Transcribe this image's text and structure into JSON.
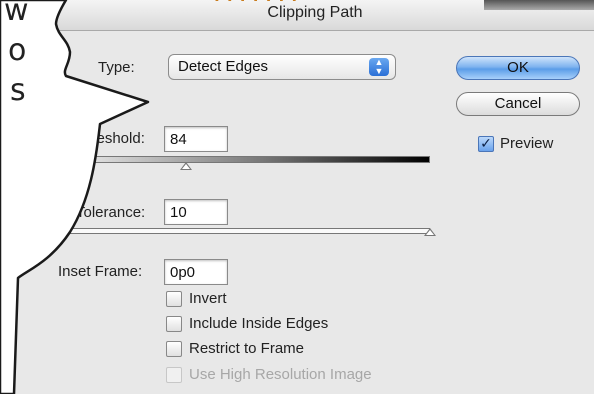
{
  "dialog": {
    "title": "Clipping Path"
  },
  "type_row": {
    "label": "Type:",
    "value": "Detect Edges",
    "arrows_glyph": "▲▼"
  },
  "threshold": {
    "label": "Threshold:",
    "value": "84",
    "slider_fraction": 0.34
  },
  "tolerance": {
    "label": "Tolerance:",
    "value": "10",
    "slider_fraction": 1.0
  },
  "inset_frame": {
    "label": "Inset Frame:",
    "value": "0p0"
  },
  "buttons": {
    "ok": "OK",
    "cancel": "Cancel"
  },
  "preview": {
    "label": "Preview",
    "checked": true
  },
  "options": [
    {
      "label": "Invert",
      "checked": false,
      "disabled": false
    },
    {
      "label": "Include Inside Edges",
      "checked": false,
      "disabled": false
    },
    {
      "label": "Restrict to Frame",
      "checked": false,
      "disabled": false
    },
    {
      "label": "Use High Resolution Image",
      "checked": false,
      "disabled": true
    }
  ],
  "speech_bubble": {
    "lines": [
      "w",
      "o",
      "s"
    ]
  },
  "colors": {
    "accent": "#5b9de8",
    "dialog_bg": "#e8e8e8",
    "icon_orange": "#c87a1a"
  }
}
